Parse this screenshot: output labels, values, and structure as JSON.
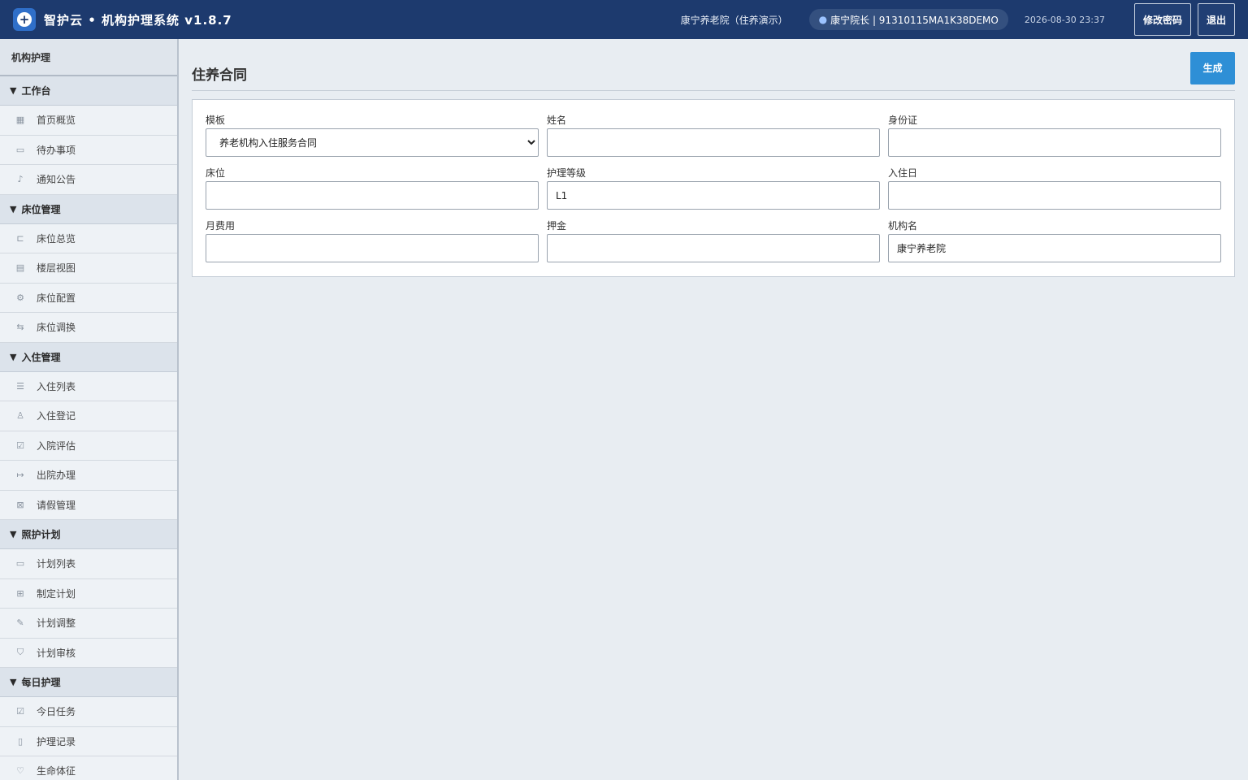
{
  "header": {
    "app_title": "智护云 • 机构护理系统 v1.8.7",
    "org_name": "康宁养老院（住养演示）",
    "user": "康宁院长 | 91310115MA1K38DEMO",
    "datetime": "2026-08-30 23:37",
    "change_password": "修改密码",
    "logout": "退出"
  },
  "sidebar": {
    "title": "机构护理",
    "groups": [
      {
        "label": "工作台",
        "items": [
          {
            "label": "首页概览",
            "icon": "grid-icon"
          },
          {
            "label": "待办事项",
            "icon": "clipboard-icon"
          },
          {
            "label": "通知公告",
            "icon": "bell-icon"
          }
        ]
      },
      {
        "label": "床位管理",
        "items": [
          {
            "label": "床位总览",
            "icon": "bed-icon"
          },
          {
            "label": "楼层视图",
            "icon": "building-icon"
          },
          {
            "label": "床位配置",
            "icon": "gear-icon"
          },
          {
            "label": "床位调换",
            "icon": "swap-icon"
          }
        ]
      },
      {
        "label": "入住管理",
        "items": [
          {
            "label": "入住列表",
            "icon": "list-icon"
          },
          {
            "label": "入住登记",
            "icon": "user-add-icon"
          },
          {
            "label": "入院评估",
            "icon": "clipboard-check-icon"
          },
          {
            "label": "出院办理",
            "icon": "exit-icon"
          },
          {
            "label": "请假管理",
            "icon": "calendar-off-icon"
          }
        ]
      },
      {
        "label": "照护计划",
        "items": [
          {
            "label": "计划列表",
            "icon": "clipboard-icon"
          },
          {
            "label": "制定计划",
            "icon": "file-add-icon"
          },
          {
            "label": "计划调整",
            "icon": "pencil-icon"
          },
          {
            "label": "计划审核",
            "icon": "shield-icon"
          }
        ]
      },
      {
        "label": "每日护理",
        "items": [
          {
            "label": "今日任务",
            "icon": "checkbox-icon"
          },
          {
            "label": "护理记录",
            "icon": "notebook-icon"
          },
          {
            "label": "生命体征",
            "icon": "heart-pulse-icon"
          }
        ]
      }
    ]
  },
  "main": {
    "title": "住养合同",
    "generate_button": "生成",
    "form": {
      "template_label": "模板",
      "template_value": "养老机构入住服务合同",
      "name_label": "姓名",
      "name_value": "",
      "id_label": "身份证",
      "id_value": "",
      "bed_label": "床位",
      "bed_value": "",
      "care_level_label": "护理等级",
      "care_level_value": "L1",
      "checkin_label": "入住日",
      "checkin_value": "",
      "monthly_fee_label": "月费用",
      "monthly_fee_value": "",
      "deposit_label": "押金",
      "deposit_value": "",
      "org_label": "机构名",
      "org_value": "康宁养老院"
    }
  },
  "colors": {
    "topbar": "#1d3a6e",
    "accent": "#2e8fd6",
    "sidebar_bg": "#eef2f6"
  }
}
